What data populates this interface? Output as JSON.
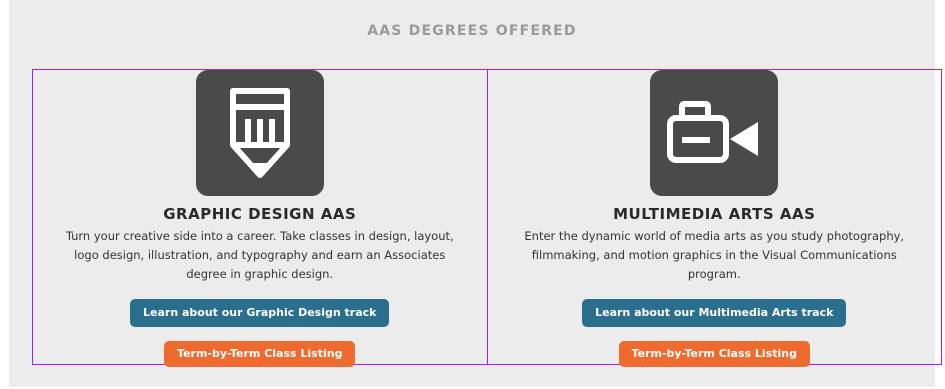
{
  "section": {
    "title": "AAS DEGREES OFFERED"
  },
  "cards": [
    {
      "icon": "pencil-icon",
      "title": "GRAPHIC DESIGN AAS",
      "description": "Turn your creative side into a career. Take classes in design, layout, logo design, illustration, and typography and earn an Associates degree in graphic design.",
      "track_button": "Learn about our Graphic Design track",
      "listing_button": "Term-by-Term Class Listing"
    },
    {
      "icon": "video-camera-icon",
      "title": "MULTIMEDIA ARTS AAS",
      "description": "Enter the dynamic world of media arts as you study photography, filmmaking, and motion graphics in the Visual Communications program.",
      "track_button": "Learn about our Multimedia Arts track",
      "listing_button": "Term-by-Term Class Listing"
    }
  ],
  "colors": {
    "panel_bg": "#ececec",
    "tile_bg": "#4a4a4a",
    "track_button": "#2a6f8e",
    "listing_button": "#ee6a2e",
    "outline": "#a020f0"
  }
}
